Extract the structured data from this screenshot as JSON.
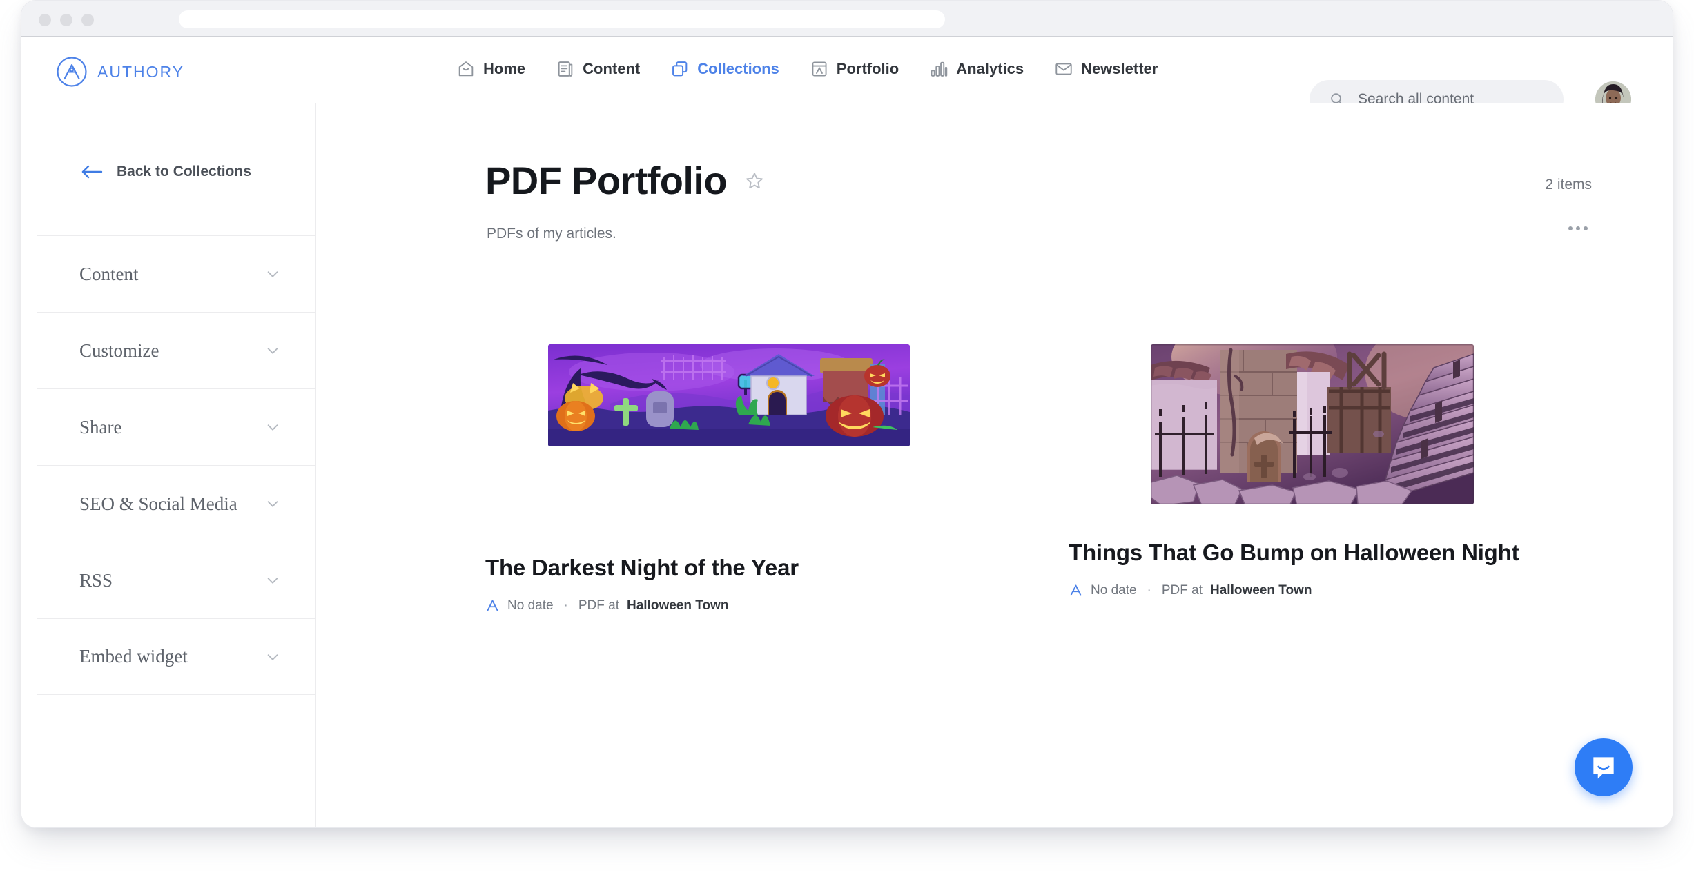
{
  "browser": {
    "url_value": "",
    "url_placeholder": ""
  },
  "brand": {
    "name": "AUTHORY"
  },
  "nav": {
    "items": [
      {
        "label": "Home",
        "icon": "home-icon",
        "active": false
      },
      {
        "label": "Content",
        "icon": "content-icon",
        "active": false
      },
      {
        "label": "Collections",
        "icon": "collections-icon",
        "active": true
      },
      {
        "label": "Portfolio",
        "icon": "portfolio-icon",
        "active": false
      },
      {
        "label": "Analytics",
        "icon": "analytics-icon",
        "active": false
      },
      {
        "label": "Newsletter",
        "icon": "newsletter-icon",
        "active": false
      }
    ],
    "active_color": "#4d82e8",
    "inactive_color": "#33373d"
  },
  "search": {
    "value": "",
    "placeholder": "Search all content",
    "icon": "search-icon"
  },
  "sidebar": {
    "back_label": "Back to Collections",
    "back_icon": "arrow-left-icon",
    "items": [
      {
        "label": "Content",
        "icon": "chevron-down-icon"
      },
      {
        "label": "Customize",
        "icon": "chevron-down-icon"
      },
      {
        "label": "Share",
        "icon": "chevron-down-icon"
      },
      {
        "label": "SEO & Social Media",
        "icon": "chevron-down-icon"
      },
      {
        "label": "RSS",
        "icon": "chevron-down-icon"
      },
      {
        "label": "Embed widget",
        "icon": "chevron-down-icon"
      }
    ]
  },
  "page": {
    "title": "PDF Portfolio",
    "star_icon": "star-outline-icon",
    "description": "PDFs of my articles.",
    "items_count": "2 items",
    "more_icon": "more-horizontal-icon"
  },
  "cards": [
    {
      "title": "The Darkest Night of the Year",
      "date": "No date",
      "separator": "·",
      "source_prefix": "PDF at",
      "source": "Halloween Town",
      "badge_icon": "authory-mark-icon",
      "thumbnail_alt": "halloween-cartoon-graveyard-thumbnail"
    },
    {
      "title": "Things That Go Bump on Halloween Night",
      "date": "No date",
      "separator": "·",
      "source_prefix": "PDF at",
      "source": "Halloween Town",
      "badge_icon": "authory-mark-icon",
      "thumbnail_alt": "purple-stone-stairway-village-thumbnail"
    }
  ],
  "chat": {
    "icon": "chat-bubble-icon",
    "color": "#2e7df6"
  }
}
